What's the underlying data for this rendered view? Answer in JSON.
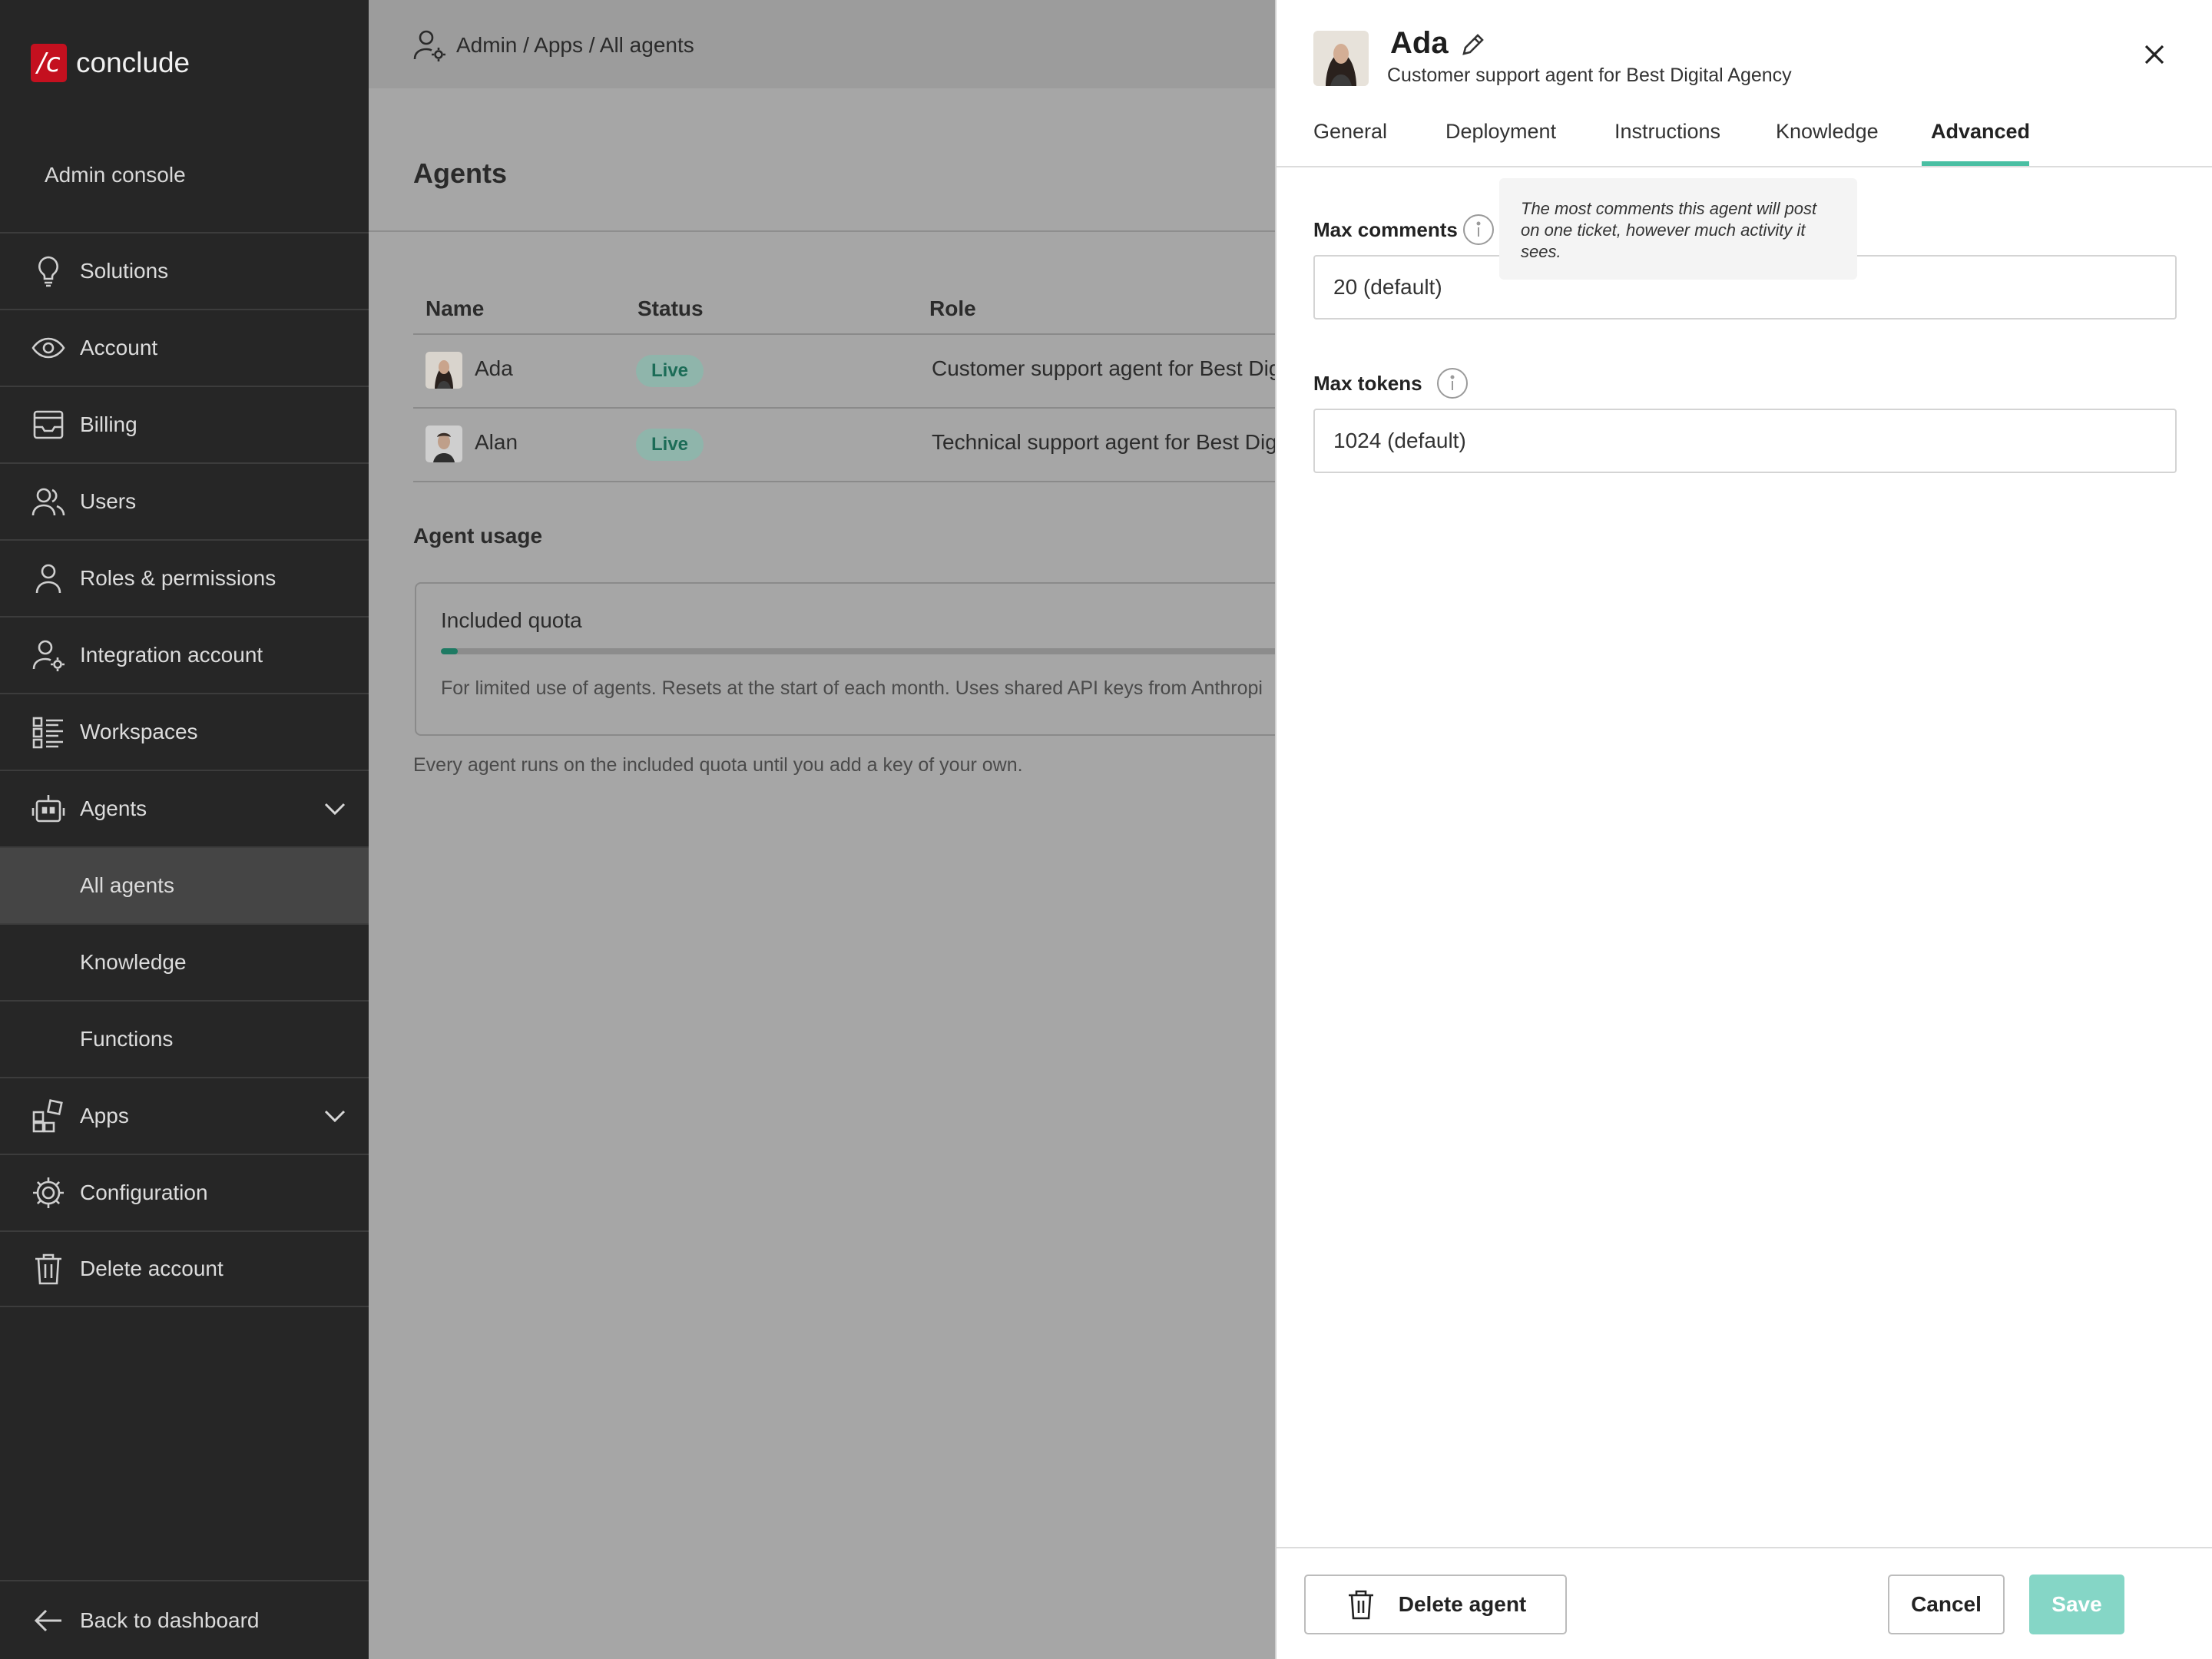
{
  "brand": {
    "mark": "/c",
    "name": "conclude"
  },
  "sidebar": {
    "section_title": "Admin console",
    "items": [
      {
        "label": "Solutions",
        "icon": "lightbulb-icon"
      },
      {
        "label": "Account",
        "icon": "eye-icon"
      },
      {
        "label": "Billing",
        "icon": "inbox-icon"
      },
      {
        "label": "Users",
        "icon": "users-icon"
      },
      {
        "label": "Roles & permissions",
        "icon": "user-icon"
      },
      {
        "label": "Integration account",
        "icon": "user-gear-icon"
      },
      {
        "label": "Workspaces",
        "icon": "list-icon"
      },
      {
        "label": "Agents",
        "icon": "robot-icon",
        "expanded": true
      },
      {
        "label": "All agents",
        "active": true
      },
      {
        "label": "Knowledge"
      },
      {
        "label": "Functions"
      },
      {
        "label": "Apps",
        "icon": "apps-icon",
        "expanded": true
      },
      {
        "label": "Configuration",
        "icon": "gear-icon"
      },
      {
        "label": "Delete account",
        "icon": "trash-icon"
      }
    ],
    "back_label": "Back to dashboard"
  },
  "breadcrumb": "Admin / Apps / All agents",
  "page_title": "Agents",
  "table": {
    "columns": [
      "Name",
      "Status",
      "Role"
    ],
    "rows": [
      {
        "name": "Ada",
        "status": "Live",
        "role": "Customer support agent for Best Digi"
      },
      {
        "name": "Alan",
        "status": "Live",
        "role": "Technical support agent for Best Digi"
      }
    ]
  },
  "usage": {
    "title": "Agent usage",
    "card_title": "Included quota",
    "progress": 0.02,
    "description": "For limited use of agents. Resets at the start of each month. Uses shared API keys from Anthropi",
    "note": "Every agent runs on the included quota until you add a key of your own."
  },
  "drawer": {
    "name": "Ada",
    "role": "Customer support agent for Best Digital Agency",
    "tabs": [
      "General",
      "Deployment",
      "Instructions",
      "Knowledge",
      "Advanced"
    ],
    "active_tab": "Advanced",
    "fields": {
      "max_comments_label": "Max comments",
      "max_comments_value": "20 (default)",
      "max_tokens_label": "Max tokens",
      "max_tokens_value": "1024 (default)"
    },
    "tooltip": "The most comments this agent will post on one ticket, however much activity it sees.",
    "buttons": {
      "delete": "Delete agent",
      "cancel": "Cancel",
      "save": "Save"
    }
  },
  "colors": {
    "accent": "#4abfa3",
    "live_badge": "#1c6c57",
    "save_button": "#85d6c6",
    "brand": "#c4101f",
    "sidebar_bg": "#262626"
  }
}
